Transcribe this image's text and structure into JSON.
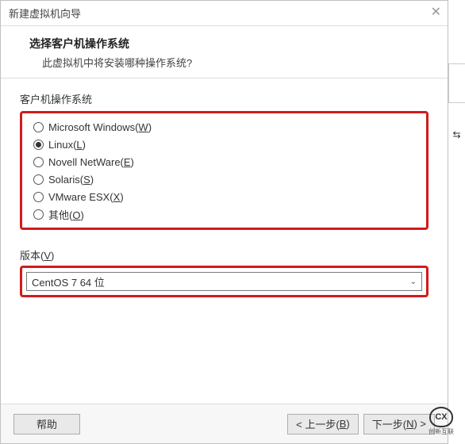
{
  "titlebar": {
    "title": "新建虚拟机向导"
  },
  "header": {
    "title": "选择客户机操作系统",
    "subtitle": "此虚拟机中将安装哪种操作系统?"
  },
  "os": {
    "section_label": "客户机操作系统",
    "options": [
      {
        "label_pre": "Microsoft Windows(",
        "shortcut": "W",
        "label_post": ")",
        "checked": false
      },
      {
        "label_pre": "Linux(",
        "shortcut": "L",
        "label_post": ")",
        "checked": true
      },
      {
        "label_pre": "Novell NetWare(",
        "shortcut": "E",
        "label_post": ")",
        "checked": false
      },
      {
        "label_pre": "Solaris(",
        "shortcut": "S",
        "label_post": ")",
        "checked": false
      },
      {
        "label_pre": "VMware ESX(",
        "shortcut": "X",
        "label_post": ")",
        "checked": false
      },
      {
        "label_pre": "其他(",
        "shortcut": "O",
        "label_post": ")",
        "checked": false
      }
    ]
  },
  "version": {
    "label_pre": "版本(",
    "shortcut": "V",
    "label_post": ")",
    "selected": "CentOS 7 64 位"
  },
  "buttons": {
    "help": "帮助",
    "back_pre": "< 上一步(",
    "back_shortcut": "B",
    "back_post": ")",
    "next_pre": "下一步(",
    "next_shortcut": "N",
    "next_post": ") >"
  },
  "brand": {
    "text": "创新互联",
    "logo": "CX"
  },
  "decor": {
    "symbol": "⇆"
  }
}
